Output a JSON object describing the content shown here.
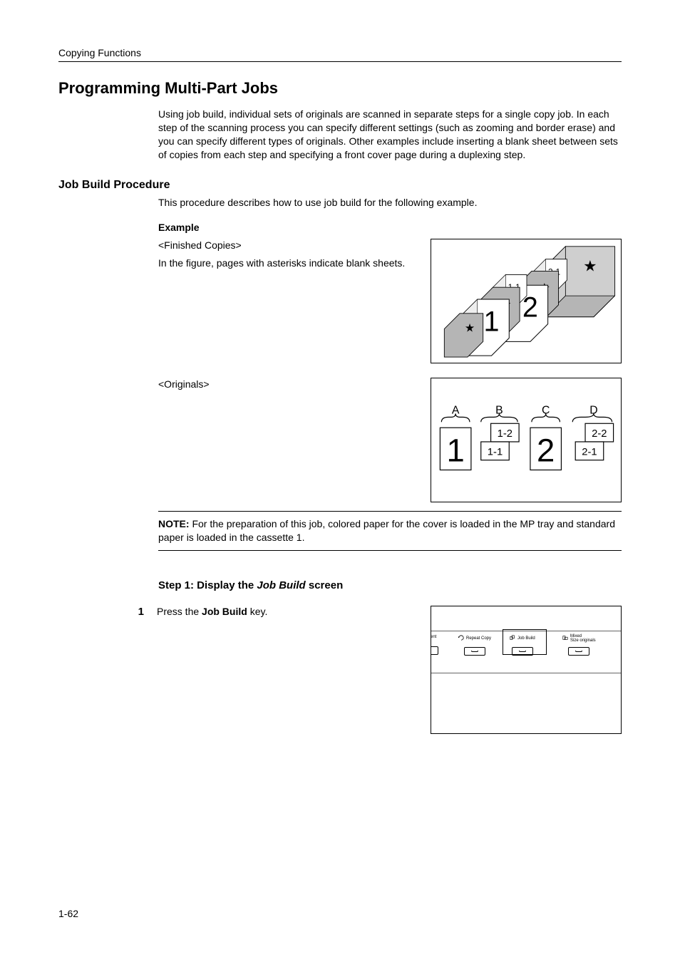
{
  "header": {
    "section": "Copying Functions"
  },
  "title": "Programming Multi-Part Jobs",
  "intro": "Using job build, individual sets of originals are scanned in separate steps for a single copy job. In each step of the scanning process you can specify different settings (such as zooming and border erase) and you can specify different types of originals. Other examples include inserting a blank sheet between sets of copies from each step and specifying a front cover page during a duplexing step.",
  "procedure_heading": "Job Build Procedure",
  "procedure_intro": "This procedure describes how to use job build for the following example.",
  "example_label": "Example",
  "finished_copies_label": "<Finished Copies>",
  "finished_copies_text": "In the figure, pages with asterisks indicate blank sheets.",
  "originals_label": "<Originals>",
  "note_prefix": "NOTE:",
  "note_text": " For the preparation of this job, colored paper for the cover is loaded in the MP tray and standard paper is loaded in the cassette 1.",
  "step1_heading_prefix": "Step 1: Display the ",
  "step1_heading_italic": "Job Build",
  "step1_heading_suffix": " screen",
  "step1_num": "1",
  "step1_text_prefix": "Press the ",
  "step1_text_bold": "Job Build",
  "step1_text_suffix": " key.",
  "panel": {
    "ment": "ment",
    "repeat_copy": "Repeat Copy",
    "job_build": "Job Build",
    "mixed_line1": "Mixed",
    "mixed_line2": "Size originals"
  },
  "fig1": {
    "big1": "1",
    "big2": "2",
    "small1": "1-1",
    "small2": "2-1"
  },
  "fig2": {
    "A": "A",
    "B": "B",
    "C": "C",
    "D": "D",
    "big1": "1",
    "big2": "2",
    "b_top": "1-2",
    "b_bot": "1-1",
    "d_top": "2-2",
    "d_bot": "2-1"
  },
  "page_number": "1-62"
}
